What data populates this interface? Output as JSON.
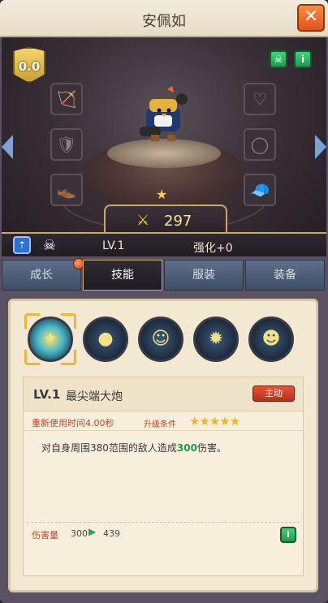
{
  "title": "安佩如",
  "close_icon": "✕",
  "level_badge": "0.0",
  "power": "297",
  "level": "LV.1",
  "enhance": "强化+0",
  "tabs": [
    "成长",
    "技能",
    "服装",
    "装备"
  ],
  "skill": {
    "level": "LV.1",
    "name": "最尖端大炮",
    "tag": "主动",
    "cooldown": "重新使用时间4.00秒",
    "upgrade_label": "升级条件",
    "stars": "★★★★★",
    "desc_prefix": "对自身周围380范围的敌人造成",
    "desc_value": "300",
    "desc_suffix": "伤害。",
    "damage_label": "伤害量",
    "damage_from": "300",
    "damage_to": "439"
  }
}
